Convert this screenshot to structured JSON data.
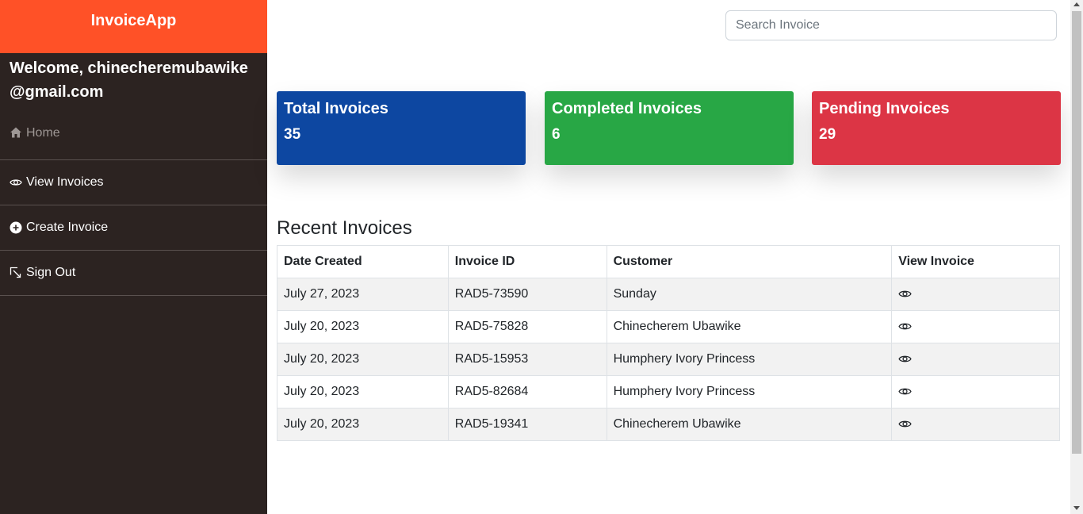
{
  "app": {
    "brand": "InvoiceApp"
  },
  "sidebar": {
    "welcome": "Welcome, chinecheremubawike@gmail.com",
    "items": [
      {
        "label": "Home",
        "icon": "home-icon"
      },
      {
        "label": "View Invoices",
        "icon": "eye-icon"
      },
      {
        "label": "Create Invoice",
        "icon": "plus-circle-icon"
      },
      {
        "label": "Sign Out",
        "icon": "sign-out-icon"
      }
    ]
  },
  "search": {
    "placeholder": "Search Invoice",
    "value": ""
  },
  "cards": {
    "total": {
      "title": "Total Invoices",
      "count": "35",
      "color": "#0d47a1"
    },
    "completed": {
      "title": "Completed Invoices",
      "count": "6",
      "color": "#28a745"
    },
    "pending": {
      "title": "Pending Invoices",
      "count": "29",
      "color": "#dc3545"
    }
  },
  "recent": {
    "title": "Recent Invoices",
    "headers": [
      "Date Created",
      "Invoice ID",
      "Customer",
      "View Invoice"
    ],
    "rows": [
      {
        "date": "July 27, 2023",
        "id": "RAD5-73590",
        "customer": "Sunday"
      },
      {
        "date": "July 20, 2023",
        "id": "RAD5-75828",
        "customer": "Chinecherem Ubawike"
      },
      {
        "date": "July 20, 2023",
        "id": "RAD5-15953",
        "customer": "Humphery Ivory Princess"
      },
      {
        "date": "July 20, 2023",
        "id": "RAD5-82684",
        "customer": "Humphery Ivory Princess"
      },
      {
        "date": "July 20, 2023",
        "id": "RAD5-19341",
        "customer": "Chinecherem Ubawike"
      }
    ]
  },
  "colors": {
    "brand": "#ff5127",
    "sidebar": "#2c2321"
  }
}
